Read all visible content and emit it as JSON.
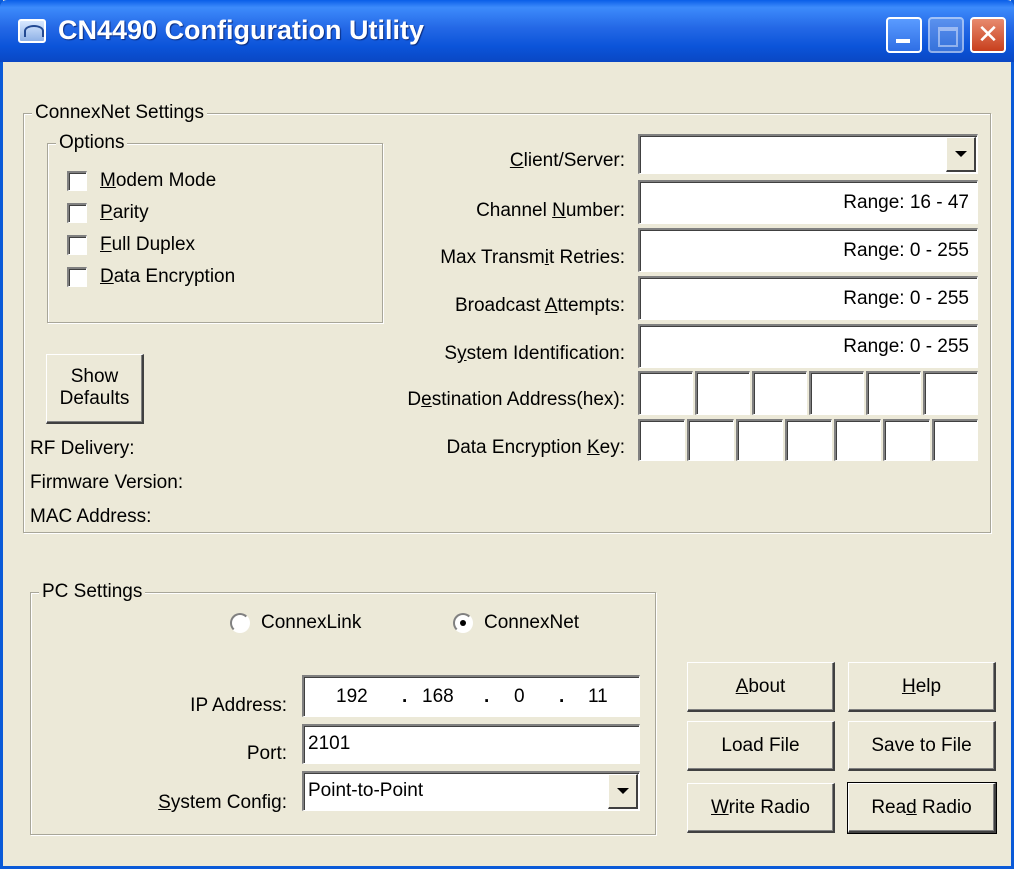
{
  "window": {
    "title": "CN4490 Configuration Utility"
  },
  "connexnet": {
    "legend": "ConnexNet Settings",
    "options_legend": "Options",
    "options": [
      {
        "label": "Modem Mode",
        "checked": false
      },
      {
        "label": "Parity",
        "checked": false
      },
      {
        "label": "Full Duplex",
        "checked": false
      },
      {
        "label": "Data Encryption",
        "checked": false
      }
    ],
    "show_defaults_line1": "Show",
    "show_defaults_line2": "Defaults",
    "info": {
      "rf_delivery": "RF Delivery:",
      "firmware_version": "Firmware Version:",
      "mac_address": "MAC Address:"
    },
    "fields": {
      "client_server_label": "Client/Server:",
      "client_server_value": "",
      "channel_label": "Channel Number:",
      "channel_range": "Range: 16 - 47",
      "retries_label": "Max Transmit Retries:",
      "retries_range": "Range: 0 - 255",
      "broadcast_label": "Broadcast Attempts:",
      "broadcast_range": "Range: 0 - 255",
      "sysid_label": "System Identification:",
      "sysid_range": "Range: 0 - 255",
      "dest_label": "Destination Address(hex):",
      "key_label": "Data Encryption Key:"
    }
  },
  "pc": {
    "legend": "PC Settings",
    "radio_connexlink": "ConnexLink",
    "radio_connexnet": "ConnexNet",
    "selected": "ConnexNet",
    "ip_label": "IP Address:",
    "ip": [
      "192",
      "168",
      "0",
      "11"
    ],
    "port_label": "Port:",
    "port_value": "2101",
    "sysconfig_label": "System Config:",
    "sysconfig_value": "Point-to-Point"
  },
  "buttons": {
    "about": "About",
    "help": "Help",
    "load_file": "Load File",
    "save_to_file": "Save to File",
    "write_radio": "Write Radio",
    "read_radio": "Read Radio"
  }
}
